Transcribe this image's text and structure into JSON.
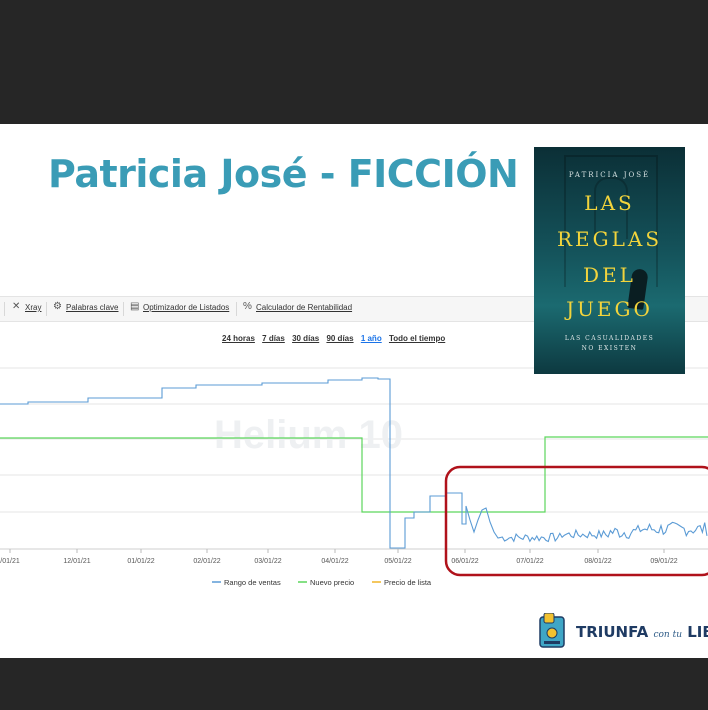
{
  "slide": {
    "title": "Patricia José - FICCIÓN"
  },
  "toolbar": {
    "items": [
      {
        "label": "Xray",
        "icon": "close-icon"
      },
      {
        "label": "Palabras clave",
        "icon": "keywords-icon"
      },
      {
        "label": "Optimizador de Listados",
        "icon": "listing-icon"
      },
      {
        "label": "Calculador de Rentabilidad",
        "icon": "percent-icon"
      }
    ]
  },
  "time_ranges": {
    "options": [
      "24 horas",
      "7 días",
      "30 días",
      "90 días",
      "1 año",
      "Todo el tiempo"
    ],
    "active": "1 año"
  },
  "chart_data": {
    "type": "line",
    "watermark": "Helium 10",
    "x_ticks": [
      "/01/21",
      "12/01/21",
      "01/01/22",
      "02/01/22",
      "03/01/22",
      "04/01/22",
      "05/01/22",
      "06/01/22",
      "07/01/22",
      "08/01/22",
      "09/01/22"
    ],
    "legend": [
      "Rango de ventas",
      "Nuevo precio",
      "Precio de lista"
    ],
    "colors": {
      "sales_rank": "#5b9bd5",
      "new_price": "#5cd65c",
      "list_price": "#f0b429",
      "highlight": "#b0121b"
    },
    "annotation": "highlighted region from 06/01/22 onward"
  },
  "book_cover": {
    "author": "PATRICIA JOSÉ",
    "title_lines": [
      "LAS",
      "REGLAS",
      "DEL",
      "JUEGO"
    ],
    "tagline_lines": [
      "LAS CASUALIDADES",
      "NO EXISTEN"
    ]
  },
  "brand": {
    "main": "TRIUNFA",
    "small": "con tu",
    "end": "LIBRO",
    "icon": "book-logo-icon"
  }
}
